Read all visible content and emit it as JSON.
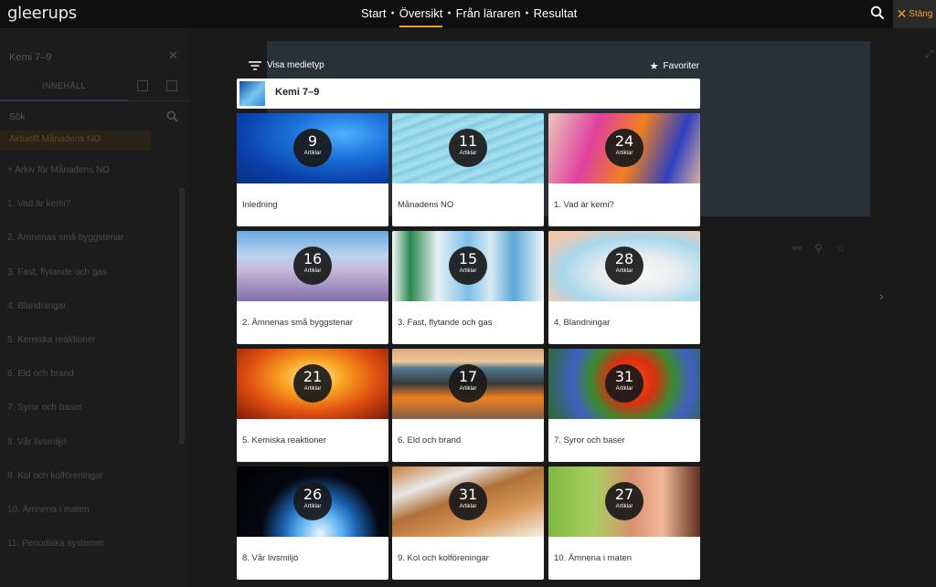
{
  "topbar": {
    "logo": "gleerups",
    "nav": [
      {
        "label": "Start",
        "active": false
      },
      {
        "label": "Översikt",
        "active": true
      },
      {
        "label": "Från läraren",
        "active": false
      },
      {
        "label": "Resultat",
        "active": false
      }
    ],
    "close_label": "Stäng",
    "accent_color": "#f0a020"
  },
  "sidebar": {
    "title": "Kemi 7–9",
    "tab_label": "INNEHÅLL",
    "search_placeholder": "Sök",
    "current": "Aktuellt Månadens NO",
    "items": [
      "+ Arkiv för Månadens NO",
      "1. Vad är kemi?",
      "2. Ämnenas små byggstenar",
      "3. Fast, flytande och gas",
      "4. Blandningar",
      "5. Kemiska reaktioner",
      "6. Eld och brand",
      "7. Syror och baser",
      "8. Vår livsmiljö",
      "9. Kol och kolföreningar",
      "10. Ämnena i maten",
      "11. Periodiska systemet"
    ]
  },
  "modal": {
    "filter_label": "Visa medietyp",
    "favorites_label": "Favoriter",
    "header_title": "Kemi 7–9",
    "badge_label": "Artiklar",
    "cards": [
      {
        "title": "Inledning",
        "count": "9",
        "image": "blue-abstract"
      },
      {
        "title": "Månadens NO",
        "count": "11",
        "image": "light-blue-water"
      },
      {
        "title": "1. Vad är kemi?",
        "count": "24",
        "image": "colorful-eye-makeup"
      },
      {
        "title": "2. Ämnenas små byggstenar",
        "count": "16",
        "image": "desert-dunes"
      },
      {
        "title": "3. Fast, flytande och gas",
        "count": "15",
        "image": "water-bottles"
      },
      {
        "title": "4. Blandningar",
        "count": "28",
        "image": "glass-of-milk"
      },
      {
        "title": "5. Kemiska reaktioner",
        "count": "21",
        "image": "candles"
      },
      {
        "title": "6. Eld och brand",
        "count": "17",
        "image": "campfire-beach"
      },
      {
        "title": "7. Syror och baser",
        "count": "31",
        "image": "poppy-flowers"
      },
      {
        "title": "8. Vår livsmiljö",
        "count": "26",
        "image": "earth-globe"
      },
      {
        "title": "9. Kol och kolföreningar",
        "count": "31",
        "image": "racket-and-ball"
      },
      {
        "title": "10. Ämnena i maten",
        "count": "27",
        "image": "boy-eating"
      }
    ]
  }
}
